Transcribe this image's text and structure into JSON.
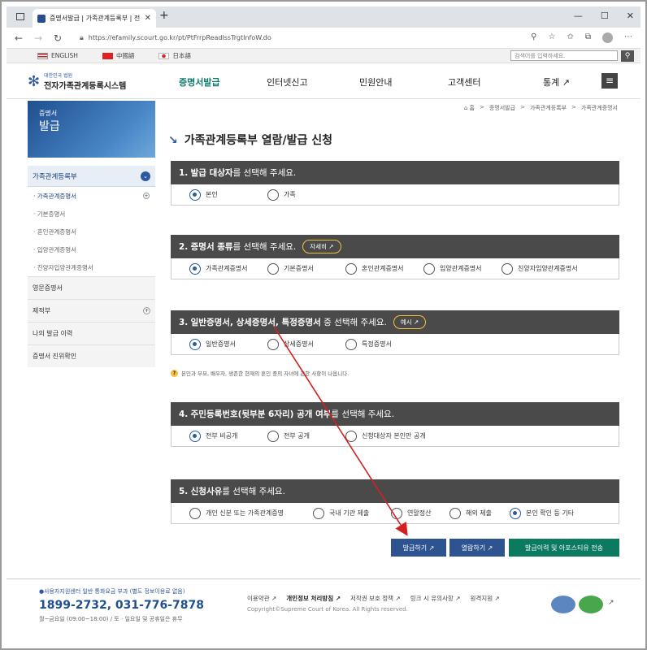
{
  "browser": {
    "tab_title": "증명서발급 | 가족관계등록부 | 전",
    "url": "https://efamily.scourt.go.kr/pt/PtFrrpReadlssTrgtInfoW.do"
  },
  "langbar": {
    "langs": [
      "ENGLISH",
      "中國語",
      "日本語"
    ],
    "search_placeholder": "검색어를 입력하세요."
  },
  "header": {
    "logo_sub": "대한민국 법원",
    "logo_title": "전자가족관계등록시스템",
    "menu": [
      "증명서발급",
      "인터넷신고",
      "민원안내",
      "고객센터",
      "통계 ↗"
    ],
    "active_index": 0
  },
  "banner": {
    "line1": "증명서",
    "line2": "발급"
  },
  "breadcrumb": [
    "⌂ 홈",
    ">",
    "증명서발급",
    ">",
    "가족관계등록부",
    ">",
    "가족관계증명서"
  ],
  "sidebar": {
    "head": "가족관계등록부",
    "subs": [
      "가족관계증명서",
      "기본증명서",
      "혼인관계증명서",
      "입양관계증명서",
      "친양자입양관계증명서"
    ],
    "mains": [
      "영문증명서",
      "제적부",
      "나의 발급 이력",
      "증명서 진위확인"
    ]
  },
  "page": {
    "title": "가족관계등록부 열람/발급 신청"
  },
  "sections": [
    {
      "num": "1.",
      "bold": "발급 대상자",
      "rest": "를 선택해 주세요.",
      "pill": "",
      "options": [
        "본인",
        "가족"
      ],
      "selected": 0
    },
    {
      "num": "2.",
      "bold": "증명서 종류",
      "rest": "를 선택해 주세요.",
      "pill": "자세히 ↗",
      "options": [
        "가족관계증명서",
        "기본증명서",
        "혼인관계증명서",
        "입양관계증명서",
        "친양자입양관계증명서"
      ],
      "selected": 0
    },
    {
      "num": "3.",
      "bold": "일반증명서, 상세증명서, 특정증명서",
      "rest": " 중 선택해 주세요.",
      "pill": "예시 ↗",
      "options": [
        "일반증명서",
        "상세증명서",
        "특정증명서"
      ],
      "selected": 0
    },
    {
      "num": "4.",
      "bold": "주민등록번호(뒷부분 6자리) 공개 여부",
      "rest": "를 선택해 주세요.",
      "pill": "",
      "options": [
        "전부 비공개",
        "전부 공개",
        "신청대상자 본인만 공개"
      ],
      "selected": 0
    },
    {
      "num": "5.",
      "bold": "신청사유",
      "rest": "를 선택해 주세요.",
      "pill": "",
      "options": [
        "개인 신분 또는 가족관계증명",
        "국내 기관 제출",
        "연말정산",
        "해외 제출",
        "본인 확인 등 기타"
      ],
      "selected": 4
    }
  ],
  "note": "본인과 부모, 배우자, 생존한 현재의 혼인 중의 자녀에 관한 사항이 나옵니다.",
  "actions": [
    "발급하기 ↗",
    "열람하기 ↗",
    "발급이력 및 아포스티유 전송"
  ],
  "footer": {
    "call": "●사용자지원센터  일반 통화요금 부과 (별도 정보이용료 없음)",
    "phone": "1899-2732, 031-776-7878",
    "hours": "월~금요일 (09:00~18:00) / 토 · 일요일 및 공휴일은 휴무",
    "links": [
      "이용약관 ↗",
      "개인정보 처리방침 ↗",
      "저작권 보호 정책 ↗",
      "링크 시 유의사항 ↗",
      "원격지원 ↗"
    ],
    "copyright": "Copyright©Supreme Court of Korea. All Rights reserved."
  },
  "colors": {
    "accent": "#2b5aa0",
    "active_menu": "#0f7c6b",
    "section_head": "#4a4a4a",
    "arrow": "#d42020"
  }
}
